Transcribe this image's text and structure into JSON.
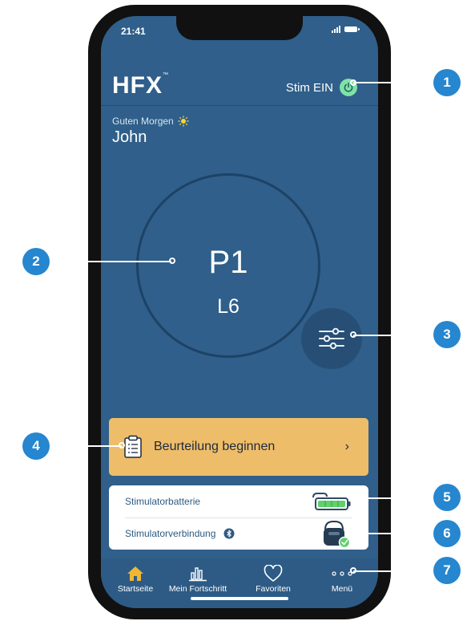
{
  "status_bar": {
    "time": "21:41"
  },
  "header": {
    "logo": "HFX",
    "logo_tm": "™",
    "stim_label": "Stim EIN"
  },
  "greeting": {
    "text": "Guten Morgen",
    "name": "John"
  },
  "program": {
    "name": "P1",
    "level": "L6"
  },
  "assessment": {
    "label": "Beurteilung beginnen",
    "chevron": "›"
  },
  "status_card": {
    "battery_label": "Stimulatorbatterie",
    "connection_label": "Stimulatorverbindung"
  },
  "nav": {
    "items": [
      {
        "label": "Startseite",
        "icon": "home-icon"
      },
      {
        "label": "Mein Fortschritt",
        "icon": "chart-icon"
      },
      {
        "label": "Favoriten",
        "icon": "heart-icon"
      },
      {
        "label": "Menü",
        "icon": "more-icon"
      }
    ]
  },
  "callouts": [
    "1",
    "2",
    "3",
    "4",
    "5",
    "6",
    "7"
  ],
  "colors": {
    "screen": "#2f5f8a",
    "accent": "#eebd6a",
    "callout": "#2686cf",
    "power": "#7fe3a8"
  }
}
